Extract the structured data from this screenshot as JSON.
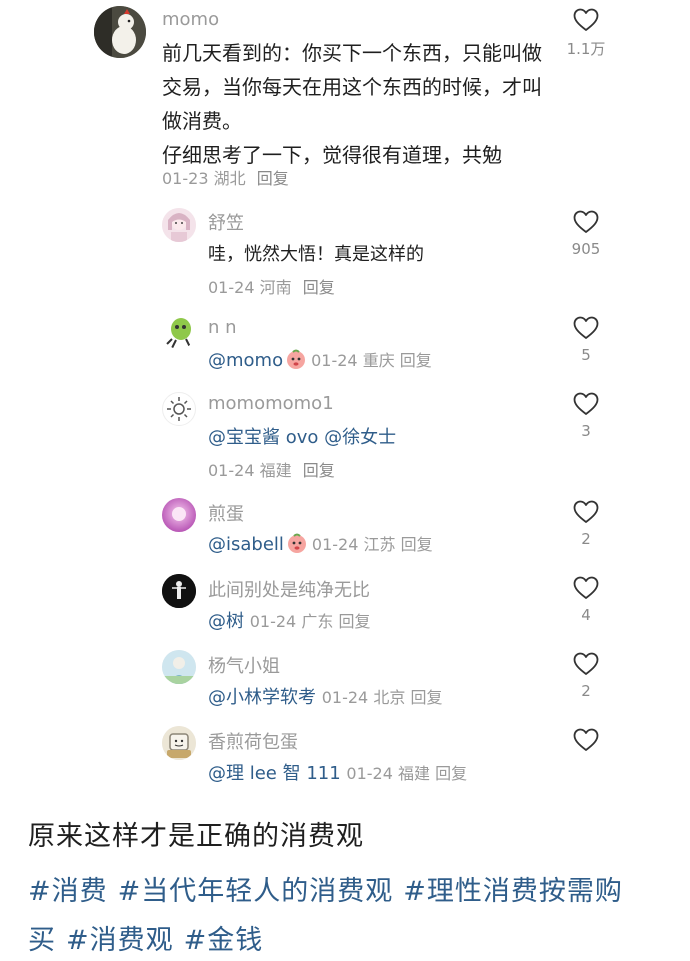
{
  "main_comment": {
    "username": "momo",
    "text_lines": [
      "前几天看到的：你买下一个东西，只能叫做",
      "交易，当你每天在用这个东西的时候，才叫",
      "做消费。",
      "仔细思考了一下，觉得很有道理，共勉"
    ],
    "date": "01-23",
    "location": "湖北",
    "reply_label": "回复",
    "likes": "1.1万"
  },
  "replies": [
    {
      "username": "舒笠",
      "text": "哇，恍然大悟！真是这样的",
      "date": "01-24",
      "location": "河南",
      "reply_label": "回复",
      "likes": "905"
    },
    {
      "username": "n n",
      "mention": "@momo",
      "date": "01-24",
      "location": "重庆",
      "reply_label": "回复",
      "likes": "5"
    },
    {
      "username": "momomomo1",
      "mention": "@宝宝酱 ovo @徐女士",
      "date": "01-24",
      "location": "福建",
      "reply_label": "回复",
      "likes": "3"
    },
    {
      "username": "煎蛋",
      "mention": "@isabell",
      "date": "01-24",
      "location": "江苏",
      "reply_label": "回复",
      "likes": "2"
    },
    {
      "username": "此间别处是纯净无比",
      "mention": "@树",
      "date": "01-24",
      "location": "广东",
      "reply_label": "回复",
      "likes": "4"
    },
    {
      "username": "杨气小姐",
      "mention": "@小林学软考",
      "date": "01-24",
      "location": "北京",
      "reply_label": "回复",
      "likes": "2"
    },
    {
      "username": "香煎荷包蛋",
      "mention": "@理 lee 智 111",
      "date": "01-24",
      "location": "福建",
      "reply_label": "回复",
      "likes": ""
    }
  ],
  "post": {
    "text": "原来这样才是正确的消费观",
    "hashtags": [
      "#消费",
      "#当代年轻人的消费观",
      "#理性消费按需购",
      "买",
      "#消费观",
      "#金钱"
    ]
  },
  "icons": {
    "like": "heart-outline-icon"
  },
  "colors": {
    "mention": "#2f5d8a",
    "meta": "#9a9a9a",
    "text": "#1f1f1f"
  }
}
